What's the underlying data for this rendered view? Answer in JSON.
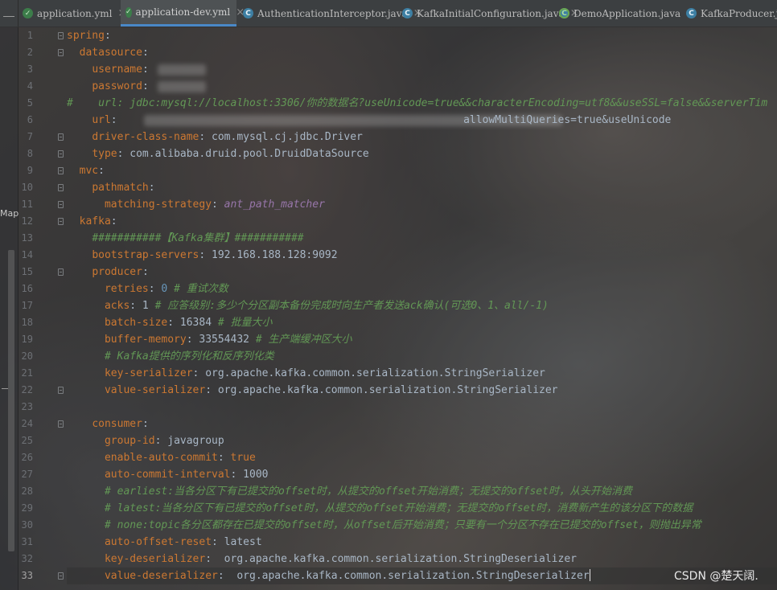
{
  "tabs": [
    {
      "label": "application.yml",
      "icon": "yml-file-icon",
      "active": false
    },
    {
      "label": "application-dev.yml",
      "icon": "yml-file-icon",
      "active": true
    },
    {
      "label": "AuthenticationInterceptor.java",
      "icon": "java-class-icon",
      "active": false
    },
    {
      "label": "KafkaInitialConfiguration.java",
      "icon": "java-class-icon",
      "active": false
    },
    {
      "label": "DemoApplication.java",
      "icon": "spring-boot-class-icon",
      "active": false
    },
    {
      "label": "KafkaProducer.java",
      "icon": "java-class-icon",
      "active": false
    }
  ],
  "sidebar": {
    "map_label": "Map"
  },
  "editor": {
    "current_line": 33,
    "lines": [
      {
        "n": "1",
        "ind": "",
        "key": "spring",
        "sep": ":",
        "val": ""
      },
      {
        "n": "2",
        "ind": "  ",
        "key": "datasource",
        "sep": ":",
        "val": ""
      },
      {
        "n": "3",
        "ind": "    ",
        "key": "username",
        "sep": ":",
        "val": ""
      },
      {
        "n": "4",
        "ind": "    ",
        "key": "password",
        "sep": ":",
        "val": ""
      },
      {
        "n": "5",
        "ind": "",
        "comment": "#    url: jdbc:mysql://localhost:3306/你的数据名?useUnicode=true&&characterEncoding=utf8&&useSSL=false&&serverTim"
      },
      {
        "n": "6",
        "ind": "    ",
        "key": "url",
        "sep": ":",
        "val": "                                                       allowMultiQueries=true&useUnicode"
      },
      {
        "n": "7",
        "ind": "    ",
        "key": "driver-class-name",
        "sep": ":",
        "val": " com.mysql.cj.jdbc.Driver"
      },
      {
        "n": "8",
        "ind": "    ",
        "key": "type",
        "sep": ":",
        "val": " com.alibaba.druid.pool.DruidDataSource"
      },
      {
        "n": "9",
        "ind": "  ",
        "key": "mvc",
        "sep": ":",
        "val": ""
      },
      {
        "n": "10",
        "ind": "    ",
        "key": "pathmatch",
        "sep": ":",
        "val": ""
      },
      {
        "n": "11",
        "ind": "      ",
        "key": "matching-strategy",
        "sep": ":",
        "enum": " ant_path_matcher"
      },
      {
        "n": "12",
        "ind": "  ",
        "key": "kafka",
        "sep": ":",
        "val": ""
      },
      {
        "n": "13",
        "ind": "    ",
        "comment": "###########【Kafka集群】###########"
      },
      {
        "n": "14",
        "ind": "    ",
        "key": "bootstrap-servers",
        "sep": ":",
        "val": " 192.168.188.128:9092"
      },
      {
        "n": "15",
        "ind": "    ",
        "key": "producer",
        "sep": ":",
        "val": ""
      },
      {
        "n": "16",
        "ind": "      ",
        "key": "retries",
        "sep": ":",
        "num": " 0",
        "comment": " # 重试次数"
      },
      {
        "n": "17",
        "ind": "      ",
        "key": "acks",
        "sep": ":",
        "val": " 1",
        "comment": " # 应答级别:多少个分区副本备份完成时向生产者发送ack确认(可选0、1、all/-1)"
      },
      {
        "n": "18",
        "ind": "      ",
        "key": "batch-size",
        "sep": ":",
        "val": " 16384",
        "comment": " # 批量大小"
      },
      {
        "n": "19",
        "ind": "      ",
        "key": "buffer-memory",
        "sep": ":",
        "val": " 33554432",
        "comment": " # 生产端缓冲区大小"
      },
      {
        "n": "20",
        "ind": "      ",
        "comment": "# Kafka提供的序列化和反序列化类"
      },
      {
        "n": "21",
        "ind": "      ",
        "key": "key-serializer",
        "sep": ":",
        "val": " org.apache.kafka.common.serialization.StringSerializer"
      },
      {
        "n": "22",
        "ind": "      ",
        "key": "value-serializer",
        "sep": ":",
        "val": " org.apache.kafka.common.serialization.StringSerializer"
      },
      {
        "n": "23",
        "ind": "",
        "val": ""
      },
      {
        "n": "24",
        "ind": "    ",
        "key": "consumer",
        "sep": ":",
        "val": ""
      },
      {
        "n": "25",
        "ind": "      ",
        "key": "group-id",
        "sep": ":",
        "val": " javagroup"
      },
      {
        "n": "26",
        "ind": "      ",
        "key": "enable-auto-commit",
        "sep": ":",
        "bool": " true"
      },
      {
        "n": "27",
        "ind": "      ",
        "key": "auto-commit-interval",
        "sep": ":",
        "val": " 1000"
      },
      {
        "n": "28",
        "ind": "      ",
        "comment": "# earliest:当各分区下有已提交的offset时，从提交的offset开始消费；无提交的offset时，从头开始消费"
      },
      {
        "n": "29",
        "ind": "      ",
        "comment": "# latest:当各分区下有已提交的offset时，从提交的offset开始消费；无提交的offset时，消费新产生的该分区下的数据"
      },
      {
        "n": "30",
        "ind": "      ",
        "comment": "# none:topic各分区都存在已提交的offset时，从offset后开始消费；只要有一个分区不存在已提交的offset，则抛出异常"
      },
      {
        "n": "31",
        "ind": "      ",
        "key": "auto-offset-reset",
        "sep": ":",
        "val": " latest"
      },
      {
        "n": "32",
        "ind": "      ",
        "key": "key-deserializer",
        "sep": ":",
        "val": "  org.apache.kafka.common.serialization.StringDeserializer"
      },
      {
        "n": "33",
        "ind": "      ",
        "key": "value-deserializer",
        "sep": ":",
        "val": "  org.apache.kafka.common.serialization.StringDeserializer"
      }
    ]
  },
  "watermark": "CSDN @楚天阔."
}
